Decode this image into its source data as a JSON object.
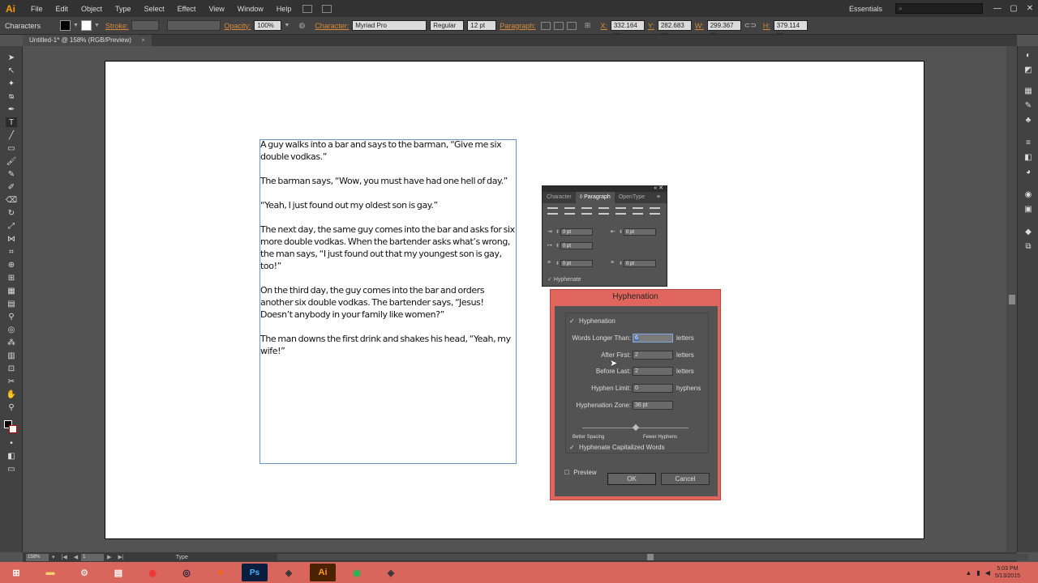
{
  "app": {
    "logo": "Ai",
    "menus": [
      "File",
      "Edit",
      "Object",
      "Type",
      "Select",
      "Effect",
      "View",
      "Window",
      "Help"
    ],
    "workspace": "Essentials",
    "window_controls": [
      "—",
      "▢",
      "✕"
    ]
  },
  "control_bar": {
    "panel_label": "Characters",
    "stroke_label": "Stroke:",
    "opacity_label": "Opacity:",
    "opacity_value": "100%",
    "character_label": "Character:",
    "font_family": "Myriad Pro",
    "font_style": "Regular",
    "font_size": "12 pt",
    "paragraph_label": "Paragraph:",
    "x_label": "X:",
    "x_value": "332.164 px",
    "y_label": "Y:",
    "y_value": "282.683 px",
    "w_label": "W:",
    "w_value": "299.367 px",
    "h_label": "H:",
    "h_value": "379.114 px"
  },
  "document_tab": {
    "title": "Untitled-1* @ 158% (RGB/Preview)",
    "close": "×"
  },
  "text_content": [
    "A guy walks into a bar and says to the barman, “Give me six double vodkas.”",
    "The barman says, “Wow, you must have had one hell of day.”",
    "“Yeah, I just found out my oldest son is gay.”",
    "The next day, the same guy comes into the bar and asks for six more double vodkas. When the bartender asks what’s wrong, the man says, “I just found out that my youngest son is gay, too!”",
    "On the third day, the guy comes into the bar and orders another six double vodkas. The bartender says, “Jesus! Doesn’t anybody in your family like women?”",
    "The man downs the first drink and shakes his head, “Yeah, my wife!”"
  ],
  "paragraph_panel": {
    "tabs": [
      "Character",
      "◊ Paragraph",
      "OpenType"
    ],
    "left_indent": "0 pt",
    "right_indent": "0 pt",
    "first_line_indent": "0 pt",
    "space_before": "0 pt",
    "space_after": "0 pt",
    "hyphenate_label": "Hyphenate"
  },
  "hyphenation_dialog": {
    "title": "Hyphenation",
    "hyphenation_label": "Hyphenation",
    "words_longer_than_label": "Words Longer Than:",
    "words_longer_than_value": "6",
    "after_first_label": "After First:",
    "after_first_value": "2",
    "before_last_label": "Before Last:",
    "before_last_value": "2",
    "hyphen_limit_label": "Hyphen Limit:",
    "hyphen_limit_value": "0",
    "hyphenation_zone_label": "Hyphenation Zone:",
    "hyphenation_zone_value": "36 pt",
    "letters_unit": "letters",
    "hyphens_unit": "hyphens",
    "slider_left": "Better Spacing",
    "slider_right": "Fewer Hyphens",
    "capitalized_label": "Hyphenate Capitalized Words",
    "preview_label": "Preview",
    "ok_label": "OK",
    "cancel_label": "Cancel"
  },
  "status_bar": {
    "zoom": "158%",
    "artboard": "1",
    "current_tool": "Type"
  },
  "taskbar": {
    "tray_up": "▲",
    "time": "5:03 PM",
    "date": "5/13/2015"
  }
}
